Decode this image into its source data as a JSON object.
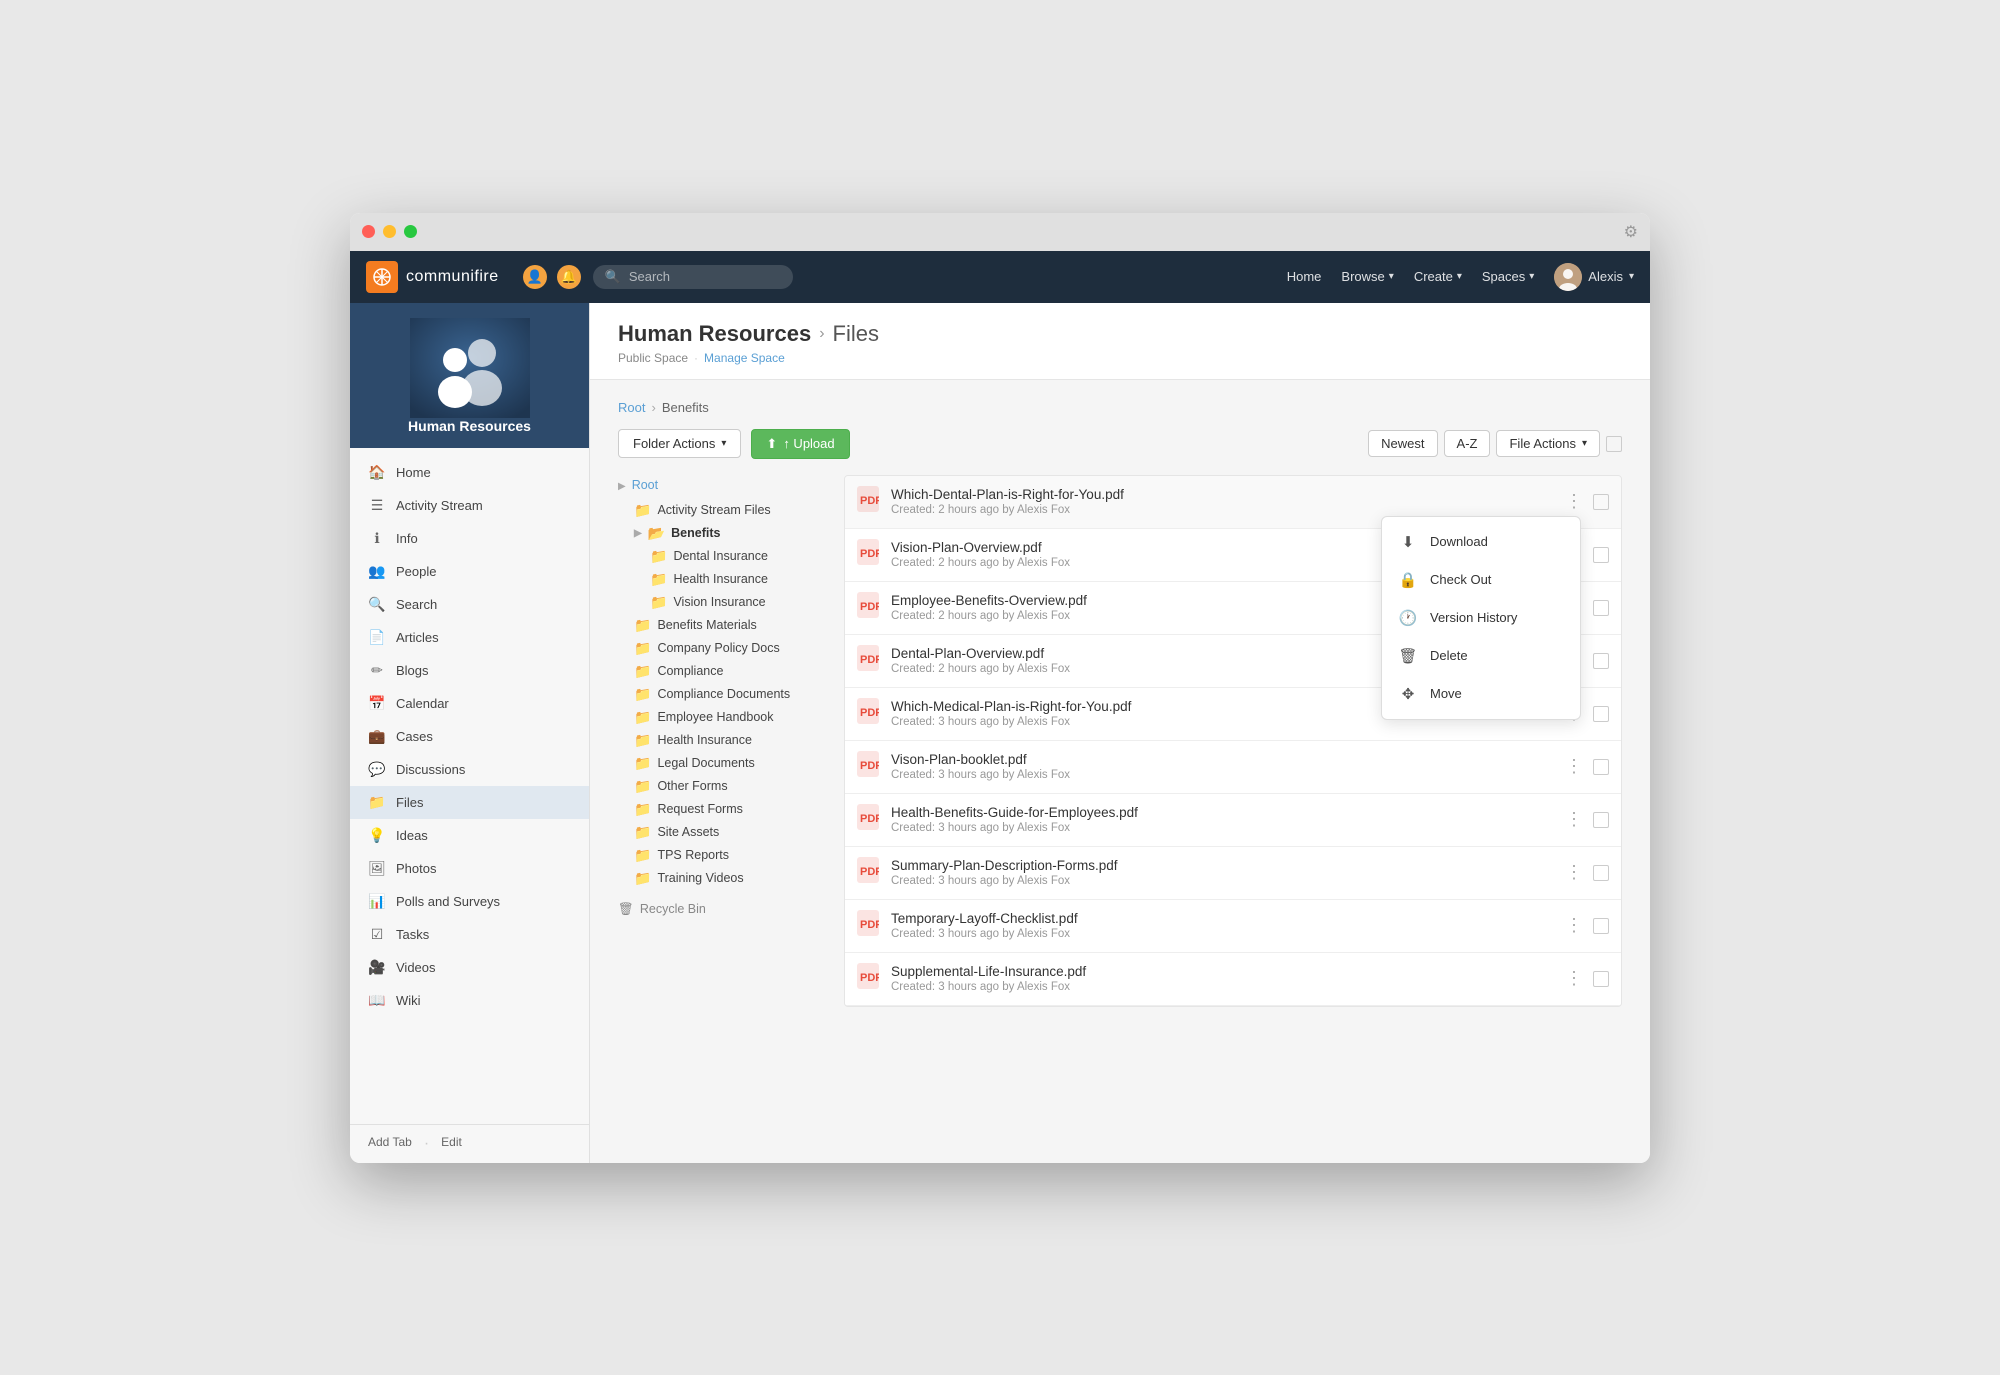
{
  "window": {
    "title": "Communifire"
  },
  "navbar": {
    "brand_name": "communifire",
    "search_placeholder": "Search",
    "links": [
      "Home",
      "Browse",
      "Create",
      "Spaces",
      "Alexis"
    ],
    "browse_label": "Browse",
    "create_label": "Create",
    "spaces_label": "Spaces",
    "user_label": "Alexis"
  },
  "sidebar": {
    "space_name": "Human Resources",
    "nav_items": [
      {
        "id": "home",
        "label": "Home",
        "icon": "🏠"
      },
      {
        "id": "activity-stream",
        "label": "Activity Stream",
        "icon": "≡"
      },
      {
        "id": "info",
        "label": "Info",
        "icon": "ℹ"
      },
      {
        "id": "people",
        "label": "People",
        "icon": "👥"
      },
      {
        "id": "search",
        "label": "Search",
        "icon": "🔍"
      },
      {
        "id": "articles",
        "label": "Articles",
        "icon": "📄"
      },
      {
        "id": "blogs",
        "label": "Blogs",
        "icon": "✏"
      },
      {
        "id": "calendar",
        "label": "Calendar",
        "icon": "📅"
      },
      {
        "id": "cases",
        "label": "Cases",
        "icon": "💼"
      },
      {
        "id": "discussions",
        "label": "Discussions",
        "icon": "💬"
      },
      {
        "id": "files",
        "label": "Files",
        "icon": "📁",
        "active": true
      },
      {
        "id": "ideas",
        "label": "Ideas",
        "icon": "💡"
      },
      {
        "id": "photos",
        "label": "Photos",
        "icon": "🖼"
      },
      {
        "id": "polls",
        "label": "Polls and Surveys",
        "icon": "📊"
      },
      {
        "id": "tasks",
        "label": "Tasks",
        "icon": "☑"
      },
      {
        "id": "videos",
        "label": "Videos",
        "icon": "🎥"
      },
      {
        "id": "wiki",
        "label": "Wiki",
        "icon": "📖"
      }
    ],
    "footer": {
      "add_tab": "Add Tab",
      "edit": "Edit"
    }
  },
  "header": {
    "space_title": "Human Resources",
    "section": "Files",
    "meta_public": "Public Space",
    "meta_manage": "Manage Space"
  },
  "toolbar": {
    "folder_actions_label": "Folder Actions",
    "upload_label": "↑ Upload",
    "sort_newest": "Newest",
    "sort_az": "A-Z",
    "file_actions_label": "File Actions"
  },
  "breadcrumb": {
    "root": "Root",
    "current": "Benefits"
  },
  "tree": {
    "root_label": "Root",
    "items": [
      {
        "label": "Activity Stream Files",
        "level": 1,
        "folder": true
      },
      {
        "label": "Benefits",
        "level": 1,
        "folder": true,
        "selected": true,
        "expanded": true
      },
      {
        "label": "Dental Insurance",
        "level": 2,
        "folder": true
      },
      {
        "label": "Health Insurance",
        "level": 2,
        "folder": true
      },
      {
        "label": "Vision Insurance",
        "level": 2,
        "folder": true
      },
      {
        "label": "Benefits Materials",
        "level": 1,
        "folder": true
      },
      {
        "label": "Company Policy Docs",
        "level": 1,
        "folder": true
      },
      {
        "label": "Compliance",
        "level": 1,
        "folder": true
      },
      {
        "label": "Compliance Documents",
        "level": 1,
        "folder": true
      },
      {
        "label": "Employee Handbook",
        "level": 1,
        "folder": true
      },
      {
        "label": "Health Insurance",
        "level": 1,
        "folder": true
      },
      {
        "label": "Legal Documents",
        "level": 1,
        "folder": true
      },
      {
        "label": "Other Forms",
        "level": 1,
        "folder": true
      },
      {
        "label": "Request Forms",
        "level": 1,
        "folder": true
      },
      {
        "label": "Site Assets",
        "level": 1,
        "folder": true
      },
      {
        "label": "TPS Reports",
        "level": 1,
        "folder": true
      },
      {
        "label": "Training Videos",
        "level": 1,
        "folder": true
      }
    ],
    "recycle_bin": "Recycle Bin"
  },
  "files": [
    {
      "name": "Which-Dental-Plan-is-Right-for-You.pdf",
      "meta": "Created: 2 hours ago by Alexis Fox",
      "menu_open": true
    },
    {
      "name": "Vision-Plan-Overview.pdf",
      "meta": "Created: 2 hours ago by Alexis Fox"
    },
    {
      "name": "Employee-Benefits-Overview.pdf",
      "meta": "Created: 2 hours ago by Alexis Fox"
    },
    {
      "name": "Dental-Plan-Overview.pdf",
      "meta": "Created: 2 hours ago by Alexis Fox"
    },
    {
      "name": "Which-Medical-Plan-is-Right-for-You.pdf",
      "meta": "Created: 3 hours ago by Alexis Fox"
    },
    {
      "name": "Vison-Plan-booklet.pdf",
      "meta": "Created: 3 hours ago by Alexis Fox"
    },
    {
      "name": "Health-Benefits-Guide-for-Employees.pdf",
      "meta": "Created: 3 hours ago by Alexis Fox"
    },
    {
      "name": "Summary-Plan-Description-Forms.pdf",
      "meta": "Created: 3 hours ago by Alexis Fox"
    },
    {
      "name": "Temporary-Layoff-Checklist.pdf",
      "meta": "Created: 3 hours ago by Alexis Fox"
    },
    {
      "name": "Supplemental-Life-Insurance.pdf",
      "meta": "Created: 3 hours ago by Alexis Fox"
    }
  ],
  "dropdown": {
    "items": [
      {
        "label": "Download",
        "icon": "⬇"
      },
      {
        "label": "Check Out",
        "icon": "🔒"
      },
      {
        "label": "Version History",
        "icon": "🕐"
      },
      {
        "label": "Delete",
        "icon": "🗑"
      },
      {
        "label": "Move",
        "icon": "✥"
      }
    ]
  }
}
